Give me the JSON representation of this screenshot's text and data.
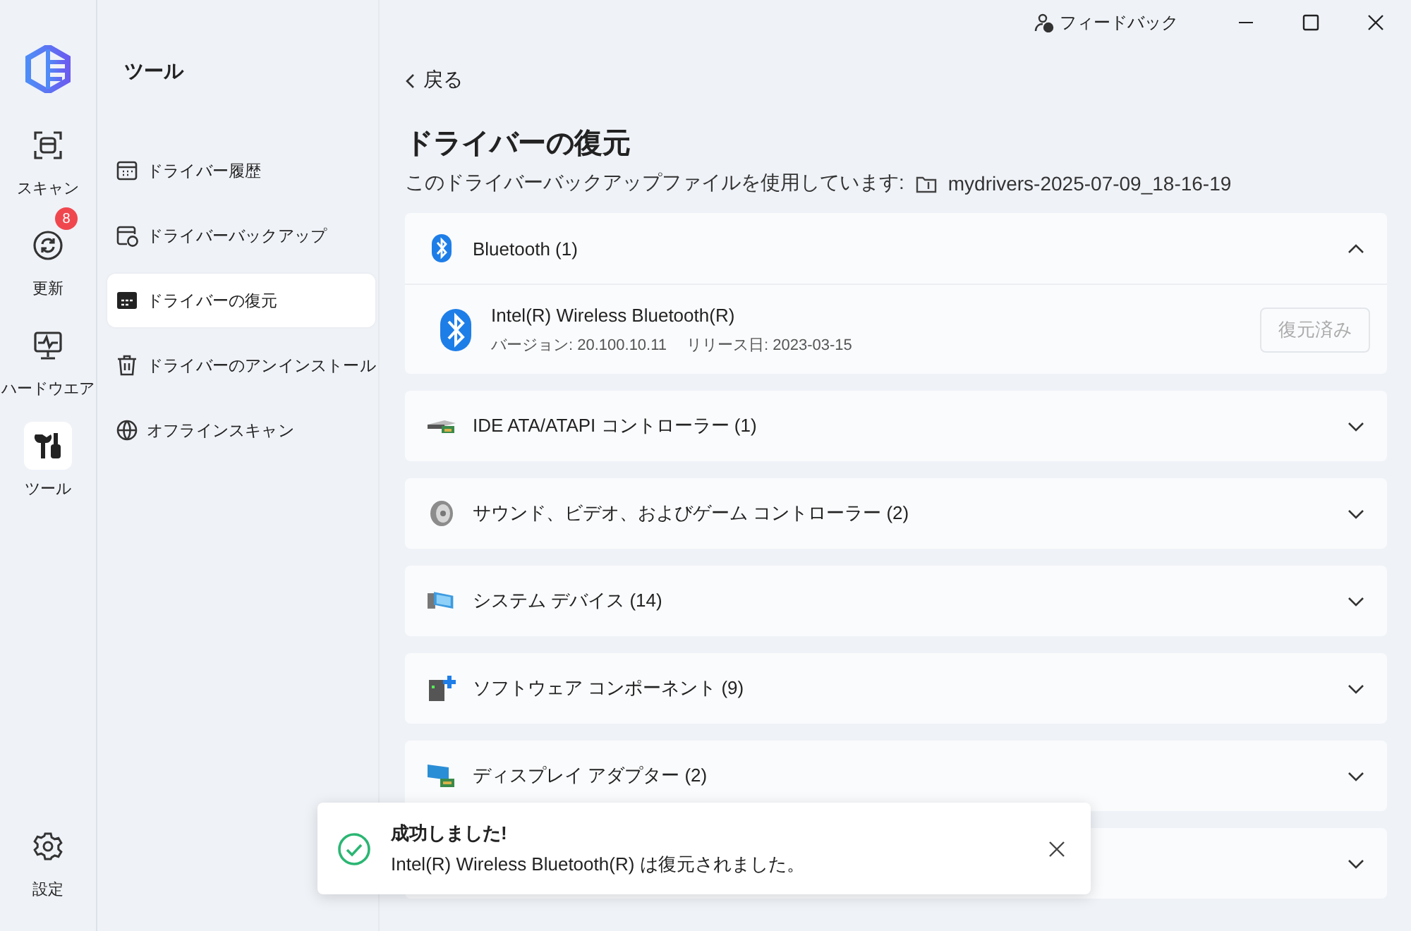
{
  "titlebar": {
    "feedback": "フィードバック"
  },
  "rail": [
    {
      "label": "スキャン",
      "selected": false
    },
    {
      "label": "更新",
      "selected": false,
      "badge": "8"
    },
    {
      "label": "ハードウエア",
      "selected": false
    },
    {
      "label": "ツール",
      "selected": true
    }
  ],
  "rail_bottom": {
    "label": "設定"
  },
  "sidebar": {
    "title": "ツール",
    "items": [
      {
        "label": "ドライバー履歴",
        "selected": false
      },
      {
        "label": "ドライバーバックアップ",
        "selected": false
      },
      {
        "label": "ドライバーの復元",
        "selected": true
      },
      {
        "label": "ドライバーのアンインストール",
        "selected": false
      },
      {
        "label": "オフラインスキャン",
        "selected": false
      }
    ]
  },
  "back": "戻る",
  "page": {
    "title": "ドライバーの復元",
    "subtitle": "このドライバーバックアップファイルを使用しています:",
    "file": "mydrivers-2025-07-09_18-16-19"
  },
  "categories": [
    {
      "kind": "bluetooth",
      "label": "Bluetooth (1)",
      "expanded": true,
      "drivers": [
        {
          "name": "Intel(R) Wireless Bluetooth(R)",
          "version": "バージョン: 20.100.10.11",
          "date": "リリース日: 2023-03-15",
          "action": "復元済み",
          "disabled": true
        }
      ]
    },
    {
      "kind": "ide",
      "label": "IDE ATA/ATAPI コントローラー (1)",
      "expanded": false
    },
    {
      "kind": "sound",
      "label": "サウンド、ビデオ、およびゲーム コントローラー (2)",
      "expanded": false
    },
    {
      "kind": "system",
      "label": "システム デバイス (14)",
      "expanded": false
    },
    {
      "kind": "software",
      "label": "ソフトウェア コンポーネント (9)",
      "expanded": false
    },
    {
      "kind": "display",
      "label": "ディスプレイ アダプター (2)",
      "expanded": false
    },
    {
      "kind": "hidden",
      "expanded": false
    }
  ],
  "toast": {
    "title": "成功しました!",
    "message": "Intel(R) Wireless Bluetooth(R) は復元されました。"
  }
}
